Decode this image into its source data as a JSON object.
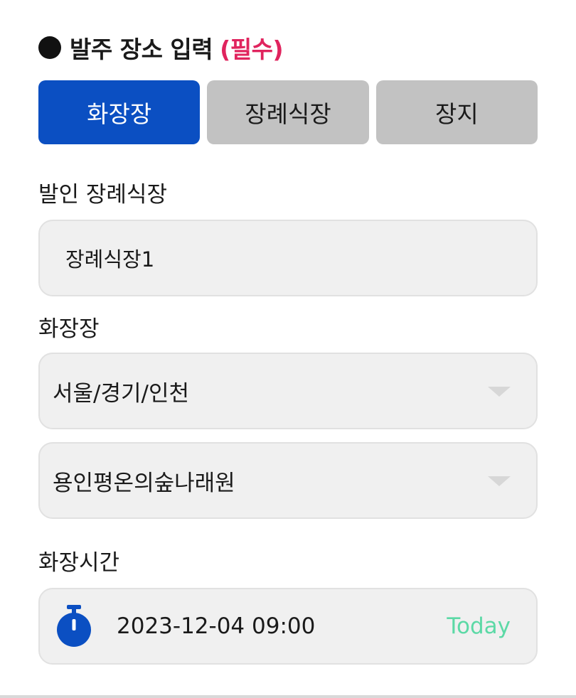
{
  "header": {
    "title": "발주 장소 입력",
    "required": "(필수)"
  },
  "tabs": [
    {
      "label": "화장장",
      "active": true
    },
    {
      "label": "장례식장",
      "active": false
    },
    {
      "label": "장지",
      "active": false
    }
  ],
  "funeral_hall": {
    "label": "발인 장례식장",
    "value": "장례식장1"
  },
  "crematorium": {
    "label": "화장장",
    "region_value": "서울/경기/인천",
    "facility_value": "용인평온의숲나래원"
  },
  "cremation_time": {
    "label": "화장시간",
    "value": "2023-12-04 09:00",
    "today_label": "Today"
  },
  "colors": {
    "accent": "#0b4fc2",
    "required": "#e0245e",
    "today": "#5cd9a6",
    "tab_inactive": "#c2c2c2",
    "field_bg": "#f0f0f0"
  },
  "icons": {
    "bullet": "filled-circle",
    "dropdown": "caret-down-icon",
    "timer": "stopwatch-icon"
  }
}
